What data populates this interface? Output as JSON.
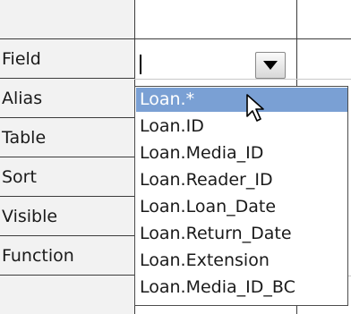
{
  "rows": [
    "Field",
    "Alias",
    "Table",
    "Sort",
    "Visible",
    "Function"
  ],
  "field": {
    "value": ""
  },
  "dropdown": {
    "items": [
      "Loan.*",
      "Loan.ID",
      "Loan.Media_ID",
      "Loan.Reader_ID",
      "Loan.Loan_Date",
      "Loan.Return_Date",
      "Loan.Extension",
      "Loan.Media_ID_BC"
    ],
    "selected": "Loan.*"
  },
  "icons": {
    "dropdown_arrow": "triangle-down-icon",
    "pointer": "mouse-pointer-icon"
  },
  "colors": {
    "selection": "#7aa0d4",
    "label_bg": "#f2f2f2"
  }
}
